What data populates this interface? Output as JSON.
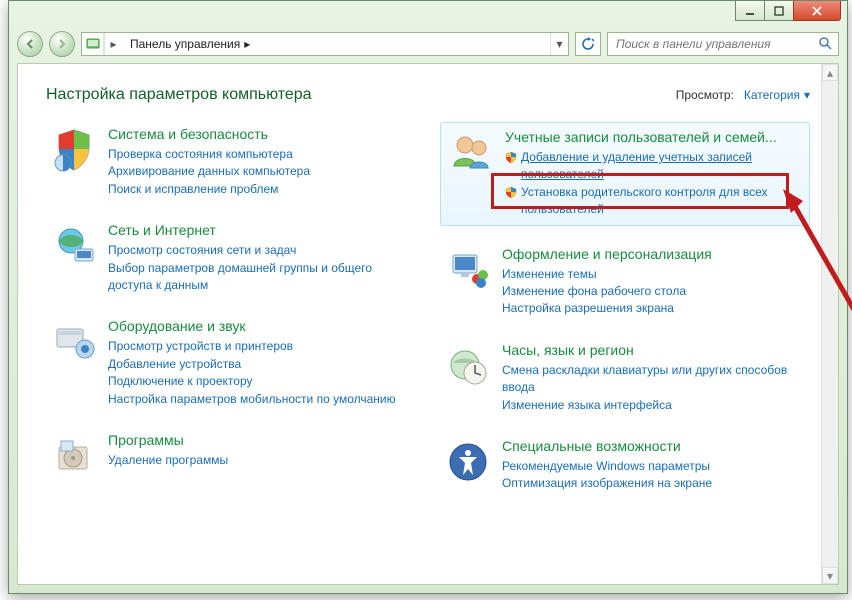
{
  "titlebar": {
    "min": "_",
    "max": "☐",
    "close": "✕"
  },
  "nav": {
    "breadcrumb": "Панель управления",
    "breadcrumb_sep": "▸",
    "search_placeholder": "Поиск в панели управления"
  },
  "header": {
    "title": "Настройка параметров компьютера",
    "view_label": "Просмотр:",
    "view_value": "Категория"
  },
  "left": [
    {
      "title": "Система и безопасность",
      "links": [
        "Проверка состояния компьютера",
        "Архивирование данных компьютера",
        "Поиск и исправление проблем"
      ]
    },
    {
      "title": "Сеть и Интернет",
      "links": [
        "Просмотр состояния сети и задач",
        "Выбор параметров домашней группы и общего доступа к данным"
      ]
    },
    {
      "title": "Оборудование и звук",
      "links": [
        "Просмотр устройств и принтеров",
        "Добавление устройства",
        "Подключение к проектору",
        "Настройка параметров мобильности по умолчанию"
      ]
    },
    {
      "title": "Программы",
      "links": [
        "Удаление программы"
      ]
    }
  ],
  "right": [
    {
      "title": "Учетные записи пользователей и семей...",
      "highlight": true,
      "shield_links": [
        "Добавление и удаление учетных записей пользователей",
        "Установка родительского контроля для всех пользователей"
      ]
    },
    {
      "title": "Оформление и персонализация",
      "links": [
        "Изменение темы",
        "Изменение фона рабочего стола",
        "Настройка разрешения экрана"
      ]
    },
    {
      "title": "Часы, язык и регион",
      "links": [
        "Смена раскладки клавиатуры или других способов ввода",
        "Изменение языка интерфейса"
      ]
    },
    {
      "title": "Специальные возможности",
      "links": [
        "Рекомендуемые Windows параметры",
        "Оптимизация изображения на экране"
      ]
    }
  ]
}
